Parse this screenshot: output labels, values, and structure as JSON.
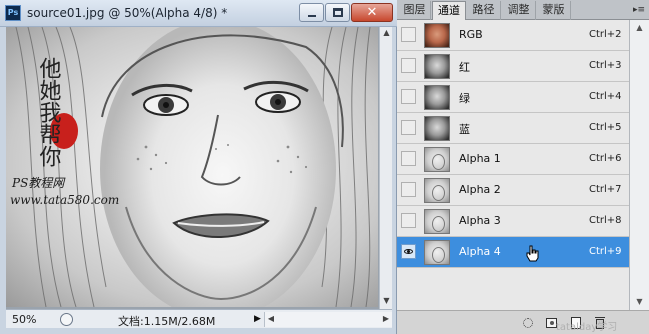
{
  "document": {
    "title": "source01.jpg @ 50%(Alpha 4/8) *",
    "app_icon_text": "Ps",
    "minimize_label": "",
    "maximize_label": "",
    "close_glyph": "✕",
    "watermark_vertical": "他她我帮你",
    "watermark_site": "PS教程网",
    "watermark_url": "www.tata580.com",
    "zoom": "50%",
    "doc_info": "文档:1.15M/2.68M",
    "status_arrow": "▶",
    "scroll_up": "▲",
    "scroll_down": "▼",
    "scroll_left": "◀",
    "scroll_right": "▶"
  },
  "panel": {
    "tabs": [
      {
        "label": "图层",
        "active": false
      },
      {
        "label": "通道",
        "active": true
      },
      {
        "label": "路径",
        "active": false
      },
      {
        "label": "调整",
        "active": false
      },
      {
        "label": "蒙版",
        "active": false
      }
    ],
    "menu_glyph": "▸≡",
    "channels": [
      {
        "name": "RGB",
        "shortcut": "Ctrl+2",
        "thumb": "rgb",
        "visible": false,
        "selected": false
      },
      {
        "name": "红",
        "shortcut": "Ctrl+3",
        "thumb": "gray",
        "visible": false,
        "selected": false
      },
      {
        "name": "绿",
        "shortcut": "Ctrl+4",
        "thumb": "gray",
        "visible": false,
        "selected": false
      },
      {
        "name": "蓝",
        "shortcut": "Ctrl+5",
        "thumb": "gray",
        "visible": false,
        "selected": false
      },
      {
        "name": "Alpha 1",
        "shortcut": "Ctrl+6",
        "thumb": "alpha",
        "visible": false,
        "selected": false
      },
      {
        "name": "Alpha 2",
        "shortcut": "Ctrl+7",
        "thumb": "alpha",
        "visible": false,
        "selected": false
      },
      {
        "name": "Alpha 3",
        "shortcut": "Ctrl+8",
        "thumb": "alpha",
        "visible": false,
        "selected": false
      },
      {
        "name": "Alpha 4",
        "shortcut": "Ctrl+9",
        "thumb": "alpha",
        "visible": true,
        "selected": true
      }
    ],
    "footer_buttons": [
      "load-selection",
      "save-selection",
      "new-channel",
      "delete-channel"
    ],
    "corner_watermark": "tatalday学习"
  },
  "colors": {
    "selection": "#3d8ede",
    "panel_bg": "#e8e8e8",
    "seal_red": "#c8201c"
  }
}
